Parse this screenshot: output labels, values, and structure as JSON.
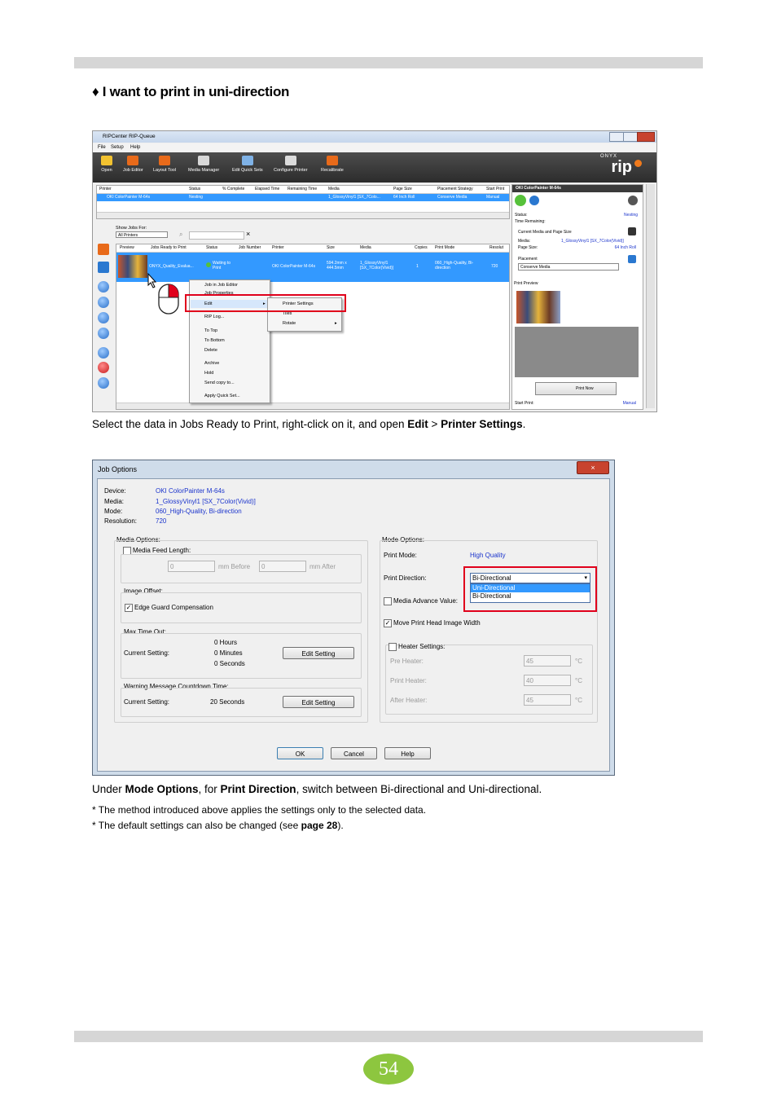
{
  "heading": "♦  I want to print in uni-direction",
  "caption1": {
    "pre": "Select the data in Jobs Ready to Print, right-click on it, and open ",
    "b1": "Edit",
    "mid": " > ",
    "b2": "Printer Settings",
    "post": "."
  },
  "caption2": {
    "pre": "Under ",
    "b1": "Mode Options",
    "mid": ", for ",
    "b2": "Print Direction",
    "post": ", switch between Bi-directional and Uni-directional."
  },
  "note1": "* The method introduced above applies the settings only to the selected data.",
  "note2": {
    "pre": "* The default settings can also be changed (see ",
    "b": "page 28",
    "post": ")."
  },
  "page_number": "54",
  "rip_queue": {
    "window_title": "RIPCenter RIP-Queue",
    "menu": [
      "File",
      "Setup",
      "Help"
    ],
    "tools": [
      "Open",
      "Job Editor",
      "Layout Tool",
      "Media Manager",
      "Edit Quick Sets",
      "Configure Printer",
      "Recalibrate"
    ],
    "brand_small": "ONYX",
    "brand_big": "rip",
    "printer_headers": [
      "Printer",
      "Status",
      "% Complete",
      "Elapsed Time",
      "Remaining Time",
      "Media",
      "Page Size",
      "Placement Strategy",
      "Start Print"
    ],
    "printer_row": [
      "OKI ColorPainter M-64s",
      "Nesting",
      "1_GlossyVinyl1 [SX_7Colo...",
      "64 Inch Roll",
      "Conserve Media",
      "Manual"
    ],
    "show_jobs_for": "Show Jobs For:",
    "filter_value": "All Printers",
    "job_headers": [
      "Preview",
      "Jobs Ready to Print",
      "Status",
      "Job Number",
      "Printer",
      "Size",
      "Media",
      "Copies",
      "Print Mode",
      "Resolut"
    ],
    "job_row": {
      "name": "ONYX_Quality_Evalua...",
      "status": "Waiting to Print",
      "printer": "OKI ColorPainter M-64s",
      "size": "594.2mm x 444.5mm",
      "media": "1_GlossyVinyl1 [SX_7Color(Vivid)]",
      "copies": "1",
      "mode": "060_High-Quality, Bi-direction",
      "res": "720"
    },
    "context_menu": [
      "Job in Job Editor",
      "Job Properties",
      "Edit",
      "RIP Log...",
      "To Top",
      "To Bottom",
      "Delete",
      "Archive",
      "Hold",
      "Send copy to...",
      "Apply Quick Set..."
    ],
    "submenu": [
      "Printer Settings",
      "Tiles",
      "Rotate"
    ],
    "panel": {
      "printer": "OKI ColorPainter M-64s",
      "status_label": "Status:",
      "status_value": "Nesting",
      "time_remaining": "Time Remaining:",
      "current_media": "Current Media and Page Size",
      "media_label": "Media:",
      "media_value": "1_GlossyVinyl1 [SX_7Color(Vivid)]",
      "page_label": "Page Size:",
      "page_value": "64 Inch Roll",
      "placement": "Placement",
      "placement_value": "Conserve Media",
      "print_preview": "Print Preview",
      "print_now": "Print Now",
      "start_print_label": "Start Print:",
      "start_print_value": "Manual"
    }
  },
  "job_options": {
    "title": "Job Options",
    "device_label": "Device:",
    "device": "OKI ColorPainter M-64s",
    "media_label": "Media:",
    "media": "1_GlossyVinyl1 [SX_7Color(Vivid)]",
    "mode_label": "Mode:",
    "mode": "060_High-Quality, Bi-direction",
    "resolution_label": "Resolution:",
    "resolution": "720",
    "media_options": "Media Options:",
    "media_feed_length": "Media Feed Length:",
    "before_value": "0",
    "before_label": "mm Before",
    "after_value": "0",
    "after_label": "mm After",
    "image_offset": "Image Offset:",
    "edge_guard": "Edge Guard Compensation",
    "max_time_out": "Max Time Out:",
    "current_setting": "Current Setting:",
    "hours": "0  Hours",
    "minutes": "0  Minutes",
    "seconds": "0  Seconds",
    "edit_setting": "Edit Setting",
    "warning_countdown": "Warning Message Countdown Time:",
    "countdown_value": "20  Seconds",
    "mode_options": "Mode Options:",
    "print_mode_label": "Print Mode:",
    "print_mode": "High Quality",
    "print_direction_label": "Print Direction:",
    "print_direction": "Bi-Directional",
    "direction_options": [
      "Uni-Directional",
      "Bi-Directional"
    ],
    "media_advance": "Media Advance Value:",
    "move_head": "Move Print Head Image Width",
    "heater_settings": "Heater Settings:",
    "pre_heater": "Pre Heater:",
    "pre_value": "45",
    "print_heater": "Print Heater:",
    "print_value": "40",
    "after_heater": "After Heater:",
    "after_heater_value": "45",
    "unit_c": "°C",
    "ok": "OK",
    "cancel": "Cancel",
    "help": "Help"
  },
  "colors": {
    "highlight_red": "#e0001b",
    "selection_blue": "#3399ff",
    "page_badge": "#8dc63f",
    "link_blue": "#1a33cc"
  }
}
